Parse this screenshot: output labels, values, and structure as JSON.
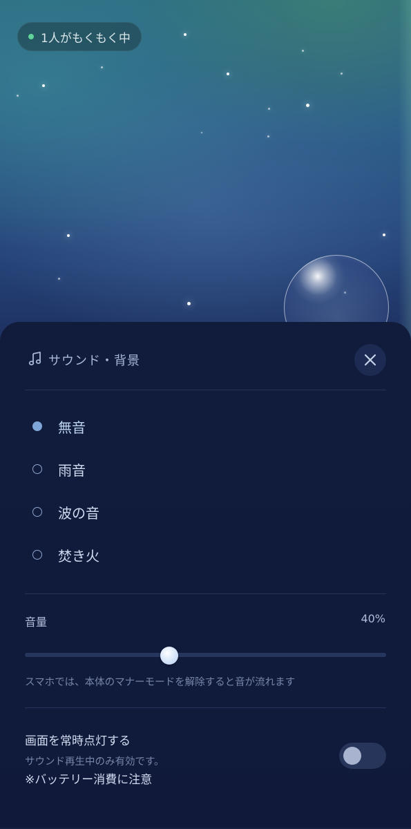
{
  "presence": {
    "label": "1人がもくもく中",
    "dot_color": "#5fd39a"
  },
  "sheet": {
    "title": "サウンド・背景",
    "title_icon": "music-note-icon",
    "close_icon": "close-icon"
  },
  "sounds": {
    "selected_index": 0,
    "options": [
      {
        "label": "無音",
        "selected": true
      },
      {
        "label": "雨音",
        "selected": false
      },
      {
        "label": "波の音",
        "selected": false
      },
      {
        "label": "焚き火",
        "selected": false
      }
    ]
  },
  "volume": {
    "label": "音量",
    "value_text": "40%",
    "value": 0.4,
    "note": "スマホでは、本体のマナーモードを解除すると音が流れます"
  },
  "screen_on": {
    "title": "画面を常時点灯する",
    "subtitle": "サウンド再生中のみ有効です。",
    "warning": "※バッテリー消費に注意",
    "enabled": false
  },
  "colors": {
    "accent": "#7fa6d8",
    "sheet_background": "#111c3c"
  }
}
